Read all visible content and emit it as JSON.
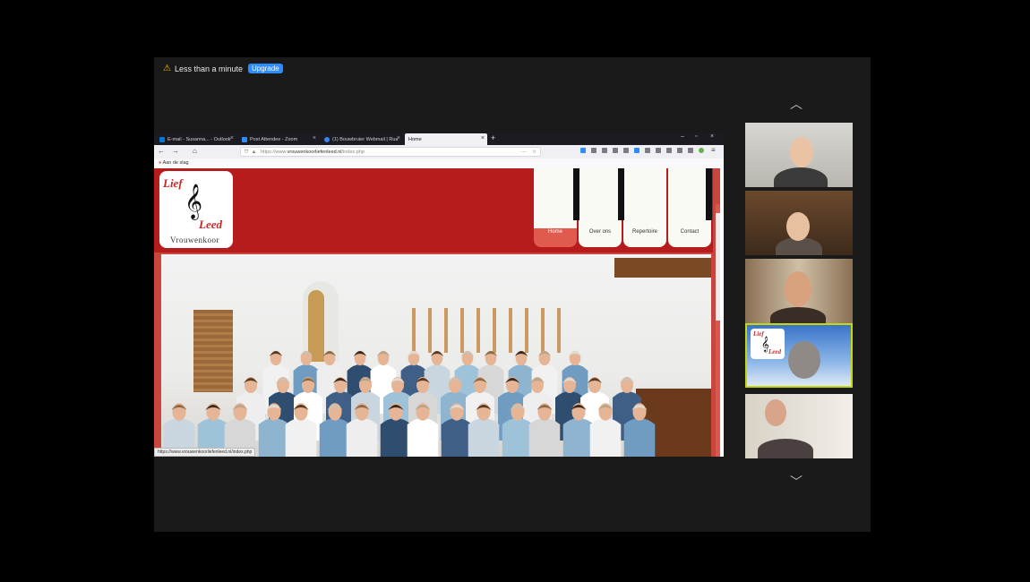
{
  "banner": {
    "warning_icon": "⚠",
    "time_text": "Less than a minute",
    "upgrade_label": "Upgrade"
  },
  "browser": {
    "tabs": [
      {
        "label": "E-mail - Susanna... - Outlook",
        "color": "#0078d4"
      },
      {
        "label": "Post Attendee - Zoom",
        "color": "#2d8cff"
      },
      {
        "label": "(1) Bouwbruier Webmail | Rua",
        "color": "#3b82f6"
      },
      {
        "label": "Home",
        "color": "#fafafa"
      }
    ],
    "url_prefix": "https://www.",
    "url_domain": "vrouwenkoorliefenleed.nl",
    "url_path": "/index.php",
    "bookmark": "Aan de slag",
    "status_url": "https://www.vrouwenkoorliefenleed.nl/index.php"
  },
  "site": {
    "logo": {
      "word1": "Lief",
      "word2": "Leed",
      "subtitle": "Vrouwenkoor",
      "clef": "𝄞"
    },
    "nav": [
      "Home",
      "Over ons",
      "Repertoire",
      "Contact"
    ]
  },
  "participants": {
    "up_arrow": "︿",
    "down_arrow": "﹀"
  }
}
